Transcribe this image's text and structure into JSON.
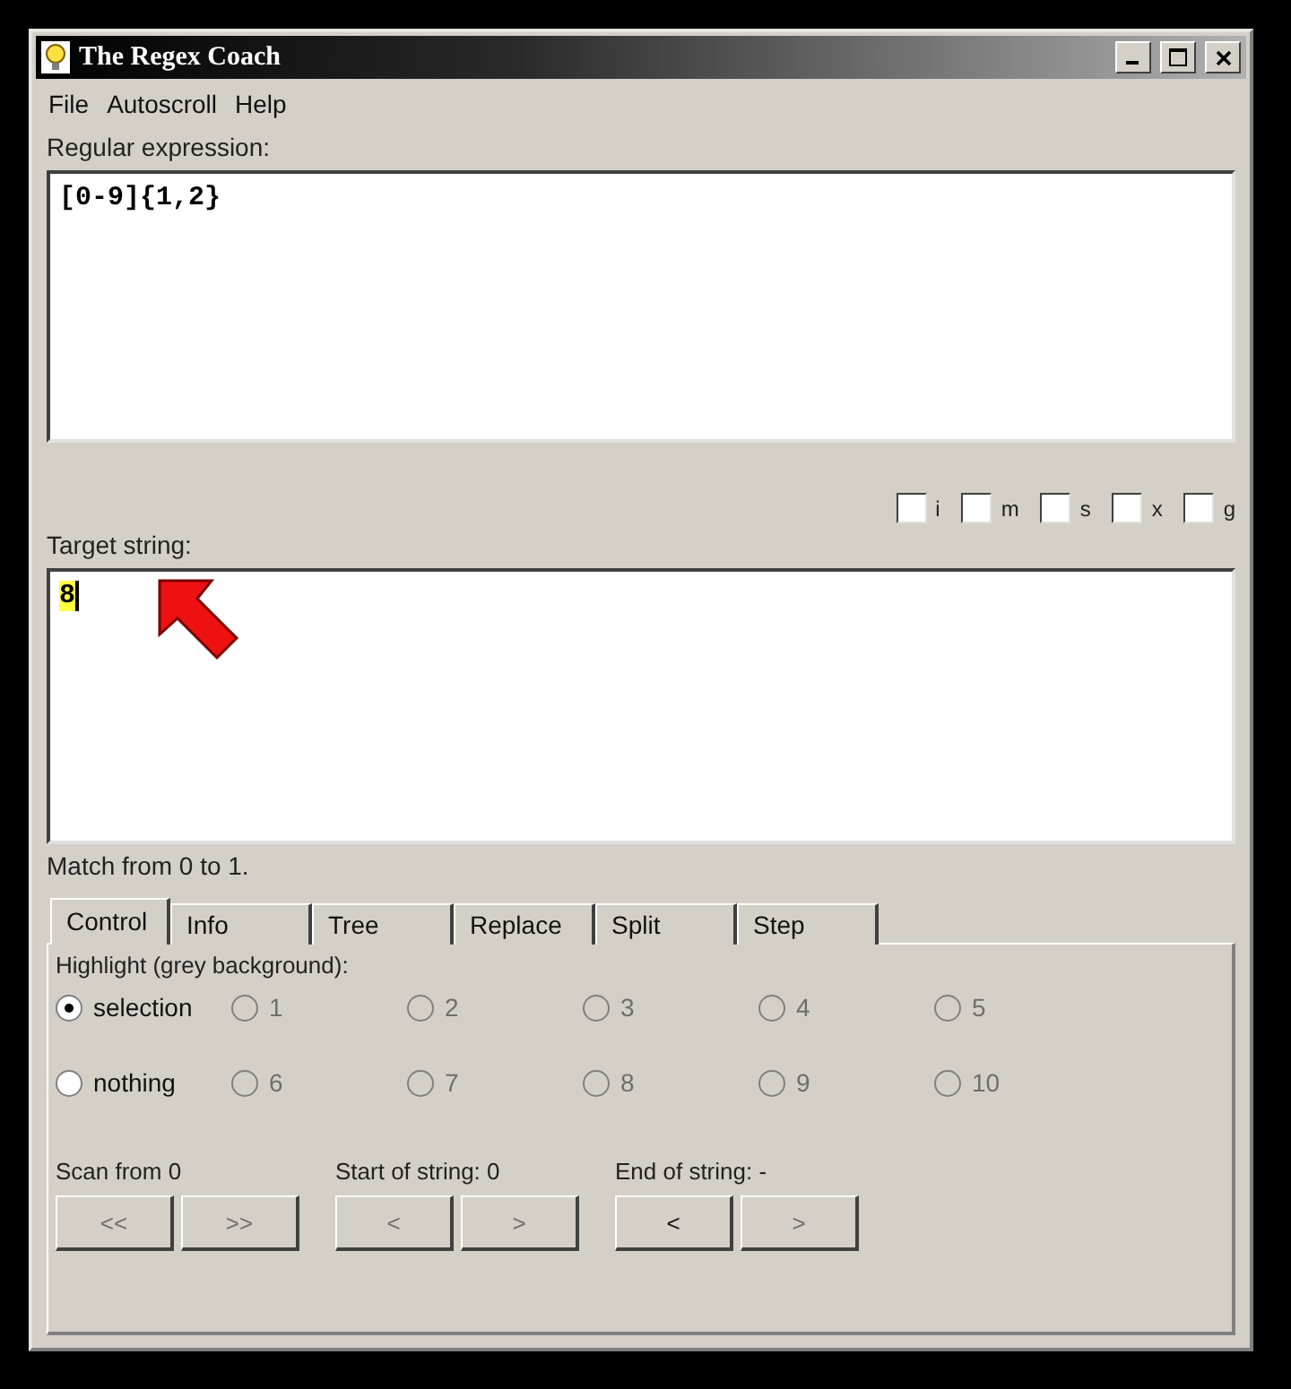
{
  "window": {
    "title": "The Regex Coach"
  },
  "menu": [
    "File",
    "Autoscroll",
    "Help"
  ],
  "regex": {
    "label": "Regular expression:",
    "value": "[0-9]{1,2}"
  },
  "modifiers": [
    {
      "label": "i",
      "checked": false
    },
    {
      "label": "m",
      "checked": false
    },
    {
      "label": "s",
      "checked": false
    },
    {
      "label": "x",
      "checked": false
    },
    {
      "label": "g",
      "checked": false
    }
  ],
  "target": {
    "label": "Target string:",
    "value": "8",
    "highlighted": true
  },
  "status": "Match from 0 to 1.",
  "tabs": [
    {
      "label": "Control",
      "selected": true
    },
    {
      "label": "Info",
      "selected": false
    },
    {
      "label": "Tree",
      "selected": false
    },
    {
      "label": "Replace",
      "selected": false
    },
    {
      "label": "Split",
      "selected": false
    },
    {
      "label": "Step",
      "selected": false
    }
  ],
  "highlight": {
    "label": "Highlight (grey background):",
    "options": [
      {
        "label": "selection",
        "selected": true,
        "disabled": false
      },
      {
        "label": "1",
        "selected": false,
        "disabled": true
      },
      {
        "label": "2",
        "selected": false,
        "disabled": true
      },
      {
        "label": "3",
        "selected": false,
        "disabled": true
      },
      {
        "label": "4",
        "selected": false,
        "disabled": true
      },
      {
        "label": "5",
        "selected": false,
        "disabled": true
      },
      {
        "label": "nothing",
        "selected": false,
        "disabled": false
      },
      {
        "label": "6",
        "selected": false,
        "disabled": true
      },
      {
        "label": "7",
        "selected": false,
        "disabled": true
      },
      {
        "label": "8",
        "selected": false,
        "disabled": true
      },
      {
        "label": "9",
        "selected": false,
        "disabled": true
      },
      {
        "label": "10",
        "selected": false,
        "disabled": true
      }
    ]
  },
  "groups": [
    {
      "label": "Scan from 0",
      "buttons": [
        {
          "label": "<<",
          "disabled": true
        },
        {
          "label": ">>",
          "disabled": true
        }
      ]
    },
    {
      "label": "Start of string: 0",
      "buttons": [
        {
          "label": "<",
          "disabled": true
        },
        {
          "label": ">",
          "disabled": true
        }
      ]
    },
    {
      "label": "End of string: -",
      "buttons": [
        {
          "label": "<",
          "disabled": false
        },
        {
          "label": ">",
          "disabled": true
        }
      ]
    }
  ]
}
